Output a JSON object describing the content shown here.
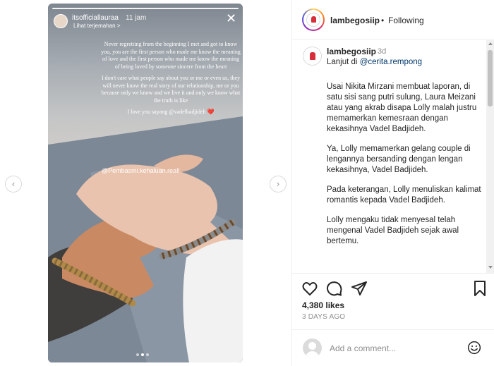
{
  "story": {
    "username": "itsofficiallauraa",
    "time": "11 jam",
    "translate": "Lihat terjemahan >",
    "caption_1": "Never regretting from the beginning I met and got to know you, you are the first person who made me know the meaning of love and the first person who made me know the meaning of being loved by someone sincere from the heart",
    "caption_2": "I don't care what people say about you or me or even us, they will never know the real story of our relationship, me or you because only we know and we live it and only we know what the truth is like",
    "caption_3": "I love you sayang @vadelbadjideh",
    "heart": "❤️",
    "watermark": "@Pembasmi.kehaluan.reall"
  },
  "header": {
    "account": "lambegosiip",
    "separator": "•",
    "follow_status": "Following"
  },
  "post": {
    "username": "lambegosiip",
    "time": "3d",
    "lead_prefix": "Lanjut di ",
    "lead_link": "@cerita.rempong",
    "paragraphs": [
      "Usai Nikita Mirzani membuat laporan, di satu sisi sang putri sulung, Laura Meizani atau yang akrab disapa Lolly malah justru memamerkan kemesraan dengan kekasihnya Vadel Badjideh.",
      "Ya, Lolly memamerkan gelang couple di lengannya bersanding dengan lengan kekasihnya, Vadel Badjideh.",
      "Pada keterangan, Lolly menuliskan kalimat romantis kepada Vadel Badjideh.",
      "Lolly mengaku tidak menyesal telah mengenal Vadel Badjideh sejak awal bertemu."
    ]
  },
  "engagement": {
    "likes": "4,380 likes",
    "posted": "3 DAYS AGO"
  },
  "comment_box": {
    "placeholder": "Add a comment..."
  },
  "icons": {
    "prev": "chevron-left-icon",
    "next": "chevron-right-icon",
    "like": "heart-icon",
    "comment": "comment-icon",
    "share": "paper-plane-icon",
    "save": "bookmark-icon",
    "emoji": "smiley-icon",
    "close": "close-icon"
  },
  "colors": {
    "link": "#00376b",
    "muted": "#8e8e8e",
    "text": "#262626",
    "heart": "#e0202d"
  },
  "story_progress": {
    "current": 2,
    "total": 3
  }
}
